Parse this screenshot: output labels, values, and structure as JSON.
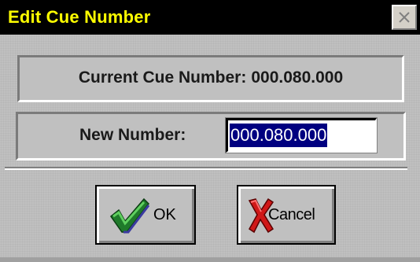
{
  "window": {
    "title": "Edit Cue Number",
    "title_color": "#ffff00",
    "titlebar_color": "#000000",
    "close_icon": "close-x-icon"
  },
  "current": {
    "label": "Current Cue Number:",
    "value": "000.080.000"
  },
  "new_number": {
    "label": "New Number:",
    "value": "000.080.000",
    "selection_color": "#000080"
  },
  "buttons": {
    "ok": {
      "label": "OK",
      "icon": "checkmark-icon",
      "icon_color": "#2e8b2e"
    },
    "cancel": {
      "label": "Cancel",
      "icon": "red-x-icon",
      "icon_color": "#cc1010"
    }
  }
}
